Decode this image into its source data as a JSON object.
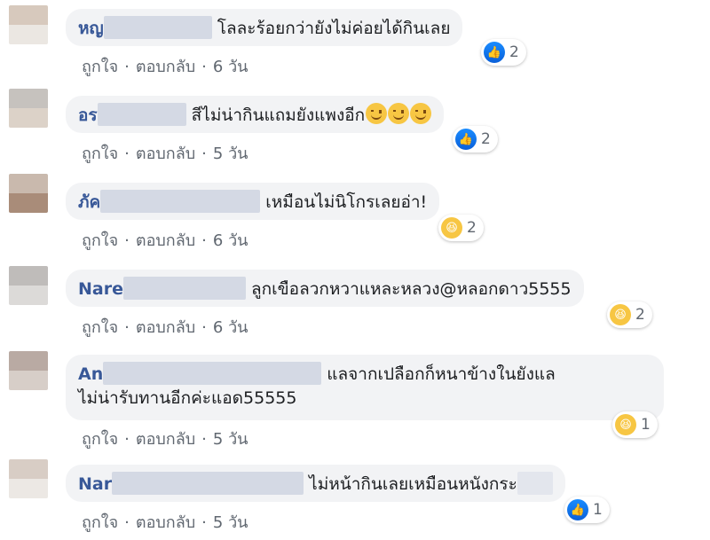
{
  "colors": {
    "name": "#385898",
    "bubble": "#f2f3f5",
    "meta": "#606770",
    "like": "#1877f2",
    "haha": "#f7c643"
  },
  "comments": [
    {
      "name": "หญ",
      "text": " โลละร้อยกว่ายังไม่ค่อยได้กินเลย",
      "like": "ถูกใจ",
      "reply": "ตอบกลับ",
      "time": "6 วัน",
      "reaction_icon": "like-icon",
      "reaction_count": "2"
    },
    {
      "name": "อร",
      "text": " สีไม่น่ากินแถมยังแพงอีก",
      "like": "ถูกใจ",
      "reply": "ตอบกลับ",
      "time": "5 วัน",
      "reaction_icon": "like-icon",
      "reaction_count": "2"
    },
    {
      "name": "ภัค",
      "text": " เหมือนไม่นิโกรเลยอ่า!",
      "like": "ถูกใจ",
      "reply": "ตอบกลับ",
      "time": "6 วัน",
      "reaction_icon": "haha-icon",
      "reaction_count": "2"
    },
    {
      "name": "Nare",
      "text": " ลูกเขือลวกหวาแหละหลวง@หลอกดาว5555",
      "like": "ถูกใจ",
      "reply": "ตอบกลับ",
      "time": "6 วัน",
      "reaction_icon": "haha-icon",
      "reaction_count": "2"
    },
    {
      "name": "An",
      "text": " แลจากเปลือกก็หนาข้างในยังแล",
      "text2": "ไม่น่ารับทานอีกค่ะแอด55555",
      "like": "ถูกใจ",
      "reply": "ตอบกลับ",
      "time": "5 วัน",
      "reaction_icon": "haha-icon",
      "reaction_count": "1"
    },
    {
      "name": "Nar",
      "text": " ไม่หน้ากินเลยเหมือนหนังกระ",
      "like": "ถูกใจ",
      "reply": "ตอบกลับ",
      "time": "5 วัน",
      "reaction_icon": "like-icon",
      "reaction_count": "1"
    }
  ]
}
